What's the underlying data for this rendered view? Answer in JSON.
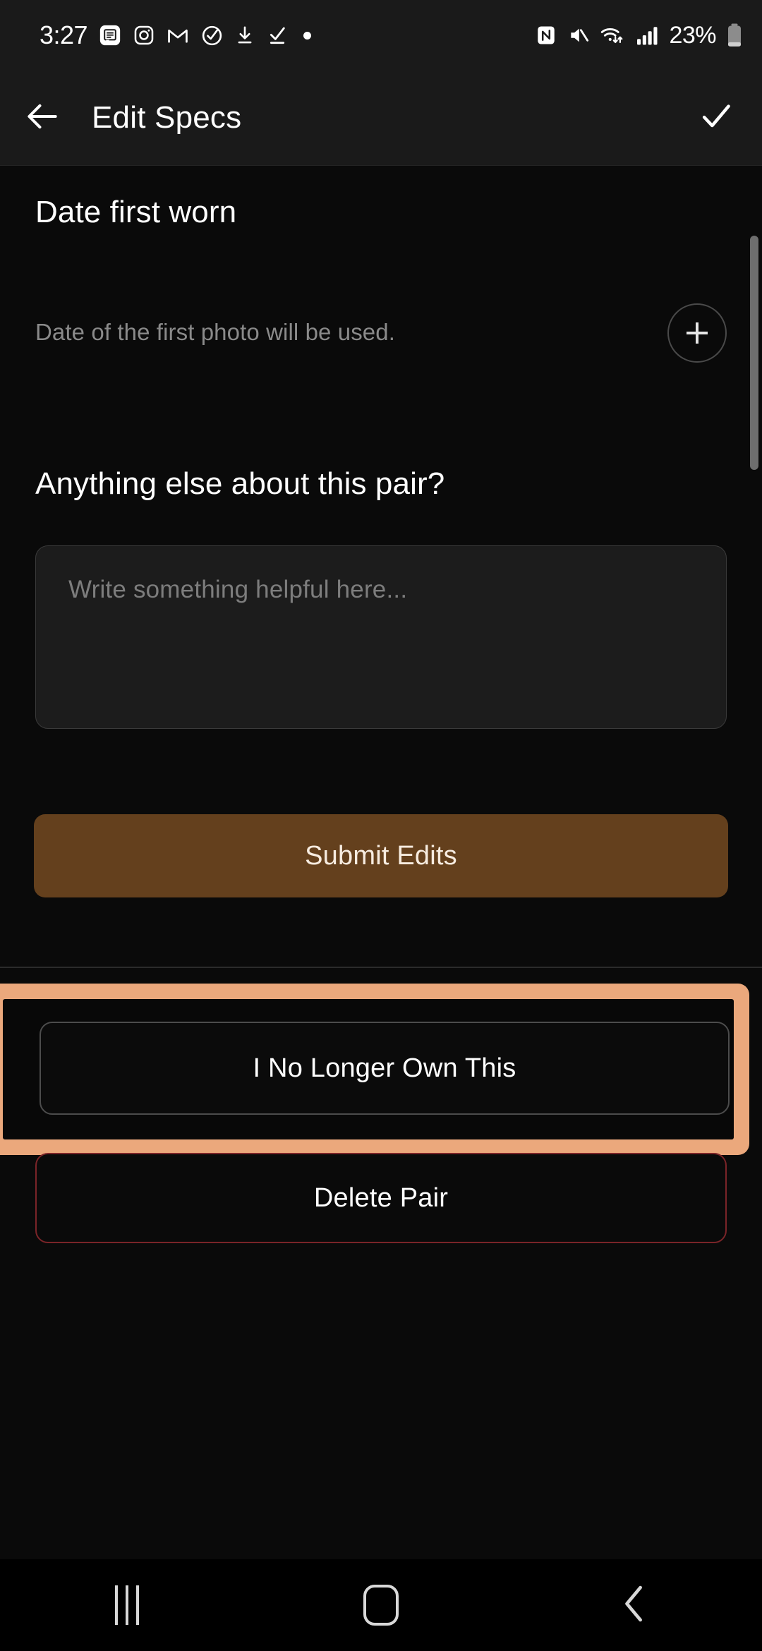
{
  "status_bar": {
    "time": "3:27",
    "left_icons": [
      "message-icon",
      "instagram-icon",
      "gmail-icon",
      "check-circle-icon",
      "download-icon",
      "task-complete-icon",
      "dot-icon"
    ],
    "right_icons": [
      "nfc-icon",
      "mute-icon",
      "wifi-icon",
      "signal-icon"
    ],
    "battery_percent": "23%",
    "battery_icon": "battery-low-icon"
  },
  "app_bar": {
    "back_icon": "back-arrow-icon",
    "title": "Edit Specs",
    "confirm_icon": "checkmark-icon"
  },
  "date_section": {
    "title": "Date first worn",
    "hint": "Date of the first photo will be used.",
    "add_icon": "plus-icon"
  },
  "notes_section": {
    "title": "Anything else about this pair?",
    "placeholder": "Write something helpful here...",
    "value": ""
  },
  "actions": {
    "submit_label": "Submit Edits",
    "no_longer_own_label": "I No Longer Own This",
    "delete_label": "Delete Pair"
  },
  "nav_bar": {
    "recents_icon": "recents-icon",
    "home_icon": "home-icon",
    "back_icon": "nav-back-icon"
  },
  "colors": {
    "submit_bg": "#64401d",
    "submit_text": "#f7ece0",
    "highlight": "#eba87c",
    "delete_border": "#7a2428",
    "app_bar_bg": "#1a1a1a",
    "page_bg": "#0a0a0a"
  }
}
